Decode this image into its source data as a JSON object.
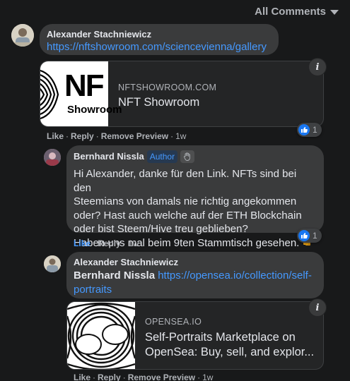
{
  "filter": {
    "label": "All Comments"
  },
  "comments": [
    {
      "author": "Alexander Stachniewicz",
      "link": "https://nftshowroom.com/sciencevienna/gallery",
      "preview": {
        "logo_text_top": "NF",
        "logo_text_bottom": "Showroom",
        "domain": "NFTSHOWROOM.COM",
        "title": "NFT Showroom"
      },
      "actions": {
        "like": "Like",
        "reply": "Reply",
        "remove": "Remove Preview",
        "time": "1w"
      },
      "reactions": {
        "count": "1"
      }
    },
    {
      "author": "Bernhard Nissla",
      "author_badge": "Author",
      "text_lines": [
        "Hi Alexander, danke für den Link. NFTs sind bei den",
        "Steemians von damals nie richtig angekommen",
        "oder? Hast auch welche auf der ETH Blockchain",
        "oder bist Steem/Hive treu geblieben?",
        "Haben uns mal beim 9ten Stammtisch gesehen."
      ],
      "actions": {
        "like": "Like",
        "reply": "Reply",
        "time": "1w"
      },
      "reactions": {
        "count": "1"
      }
    },
    {
      "author": "Alexander Stachniewicz",
      "mention": "Bernhard Nissla",
      "link_part1": "https://opensea.io/collection/self-",
      "link_part2": "portraits",
      "preview": {
        "domain": "OPENSEA.IO",
        "title_line1": "Self-Portraits Marketplace on",
        "title_line2": "OpenSea: Buy, sell, and explor..."
      },
      "actions": {
        "like": "Like",
        "reply": "Reply",
        "remove": "Remove Preview",
        "time": "1w"
      }
    }
  ],
  "colors": {
    "link": "#4599ff",
    "like_blue": "#1877f2",
    "bubble": "#3a3b3c",
    "bg": "#18191a"
  },
  "icons": {
    "info": "i"
  }
}
